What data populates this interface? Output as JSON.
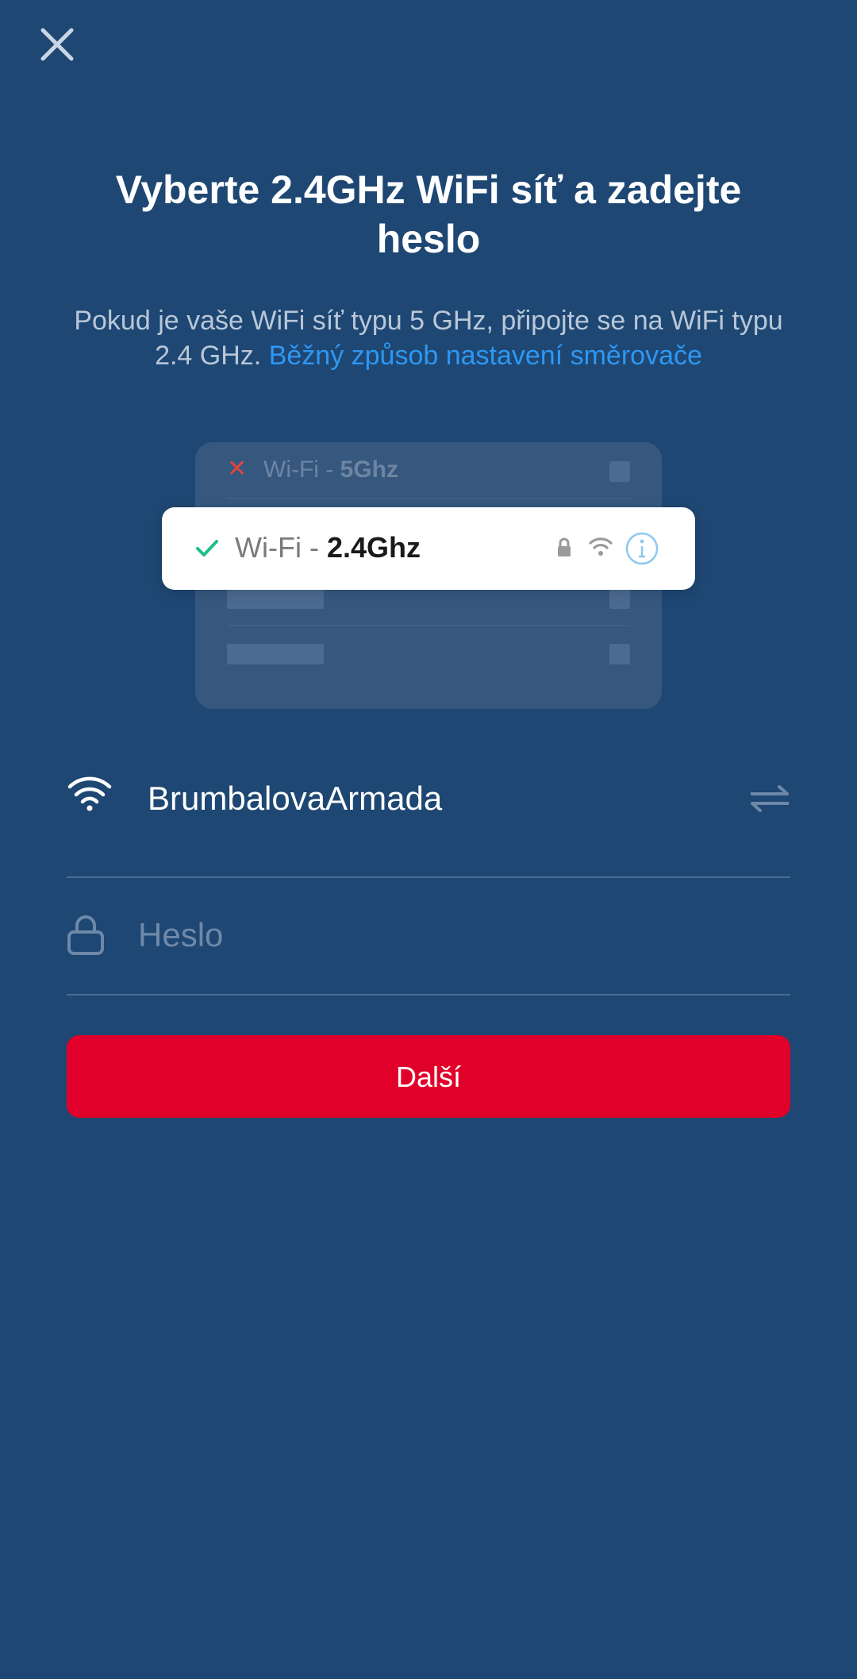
{
  "header": {
    "close_icon": "close-icon"
  },
  "title": "Vyberte 2.4GHz WiFi síť a zadejte heslo",
  "subtitle": {
    "text": "Pokud je vaše WiFi síť typu 5 GHz, připojte se na WiFi typu 2.4 GHz.",
    "link": "Běžný způsob nastavení směrovače"
  },
  "illustration": {
    "row_5ghz": {
      "prefix": "Wi-Fi - ",
      "band": "5Ghz",
      "status_icon": "x-icon"
    },
    "row_24ghz": {
      "prefix": "Wi-Fi - ",
      "band": "2.4Ghz",
      "status_icon": "check-icon"
    }
  },
  "form": {
    "network_name": "BrumbalovaArmada",
    "password_placeholder": "Heslo",
    "password_value": ""
  },
  "next_button": "Další",
  "colors": {
    "background": "#1E4773",
    "accent_link": "#2E97F2",
    "primary_button": "#E1002A",
    "check_green": "#1FBF83",
    "x_red": "#E0453F"
  }
}
